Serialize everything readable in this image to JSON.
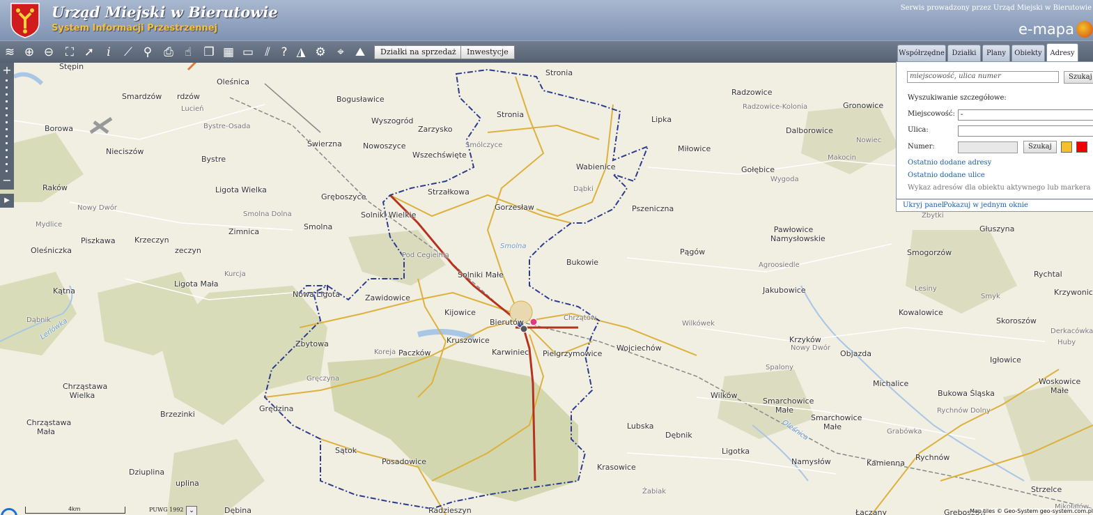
{
  "header": {
    "title": "Urząd Miejski w Bierutowie",
    "subtitle": "System Informacji Przestrzennej",
    "provider": "Serwis prowadzony przez Urząd Miejski w Bierutowie",
    "brand": "e-mapa"
  },
  "toolbar": {
    "icons": [
      "layers-icon",
      "zoom-in-icon",
      "zoom-out-icon",
      "zoom-extent-icon",
      "select-arrow-icon",
      "info-icon",
      "measure-ruler-icon",
      "measure-clip-icon",
      "print-icon",
      "pan-hand-icon",
      "copy-icon",
      "layout-icon",
      "speech-bubble-icon",
      "hatch-icon",
      "help-icon",
      "triangle-icon",
      "settings-gear-icon",
      "pin-search-icon",
      "terrain-icon"
    ],
    "btn_dzialki": "Działki na sprzedaż",
    "btn_inwestycje": "Inwestycje"
  },
  "panel": {
    "tabs": [
      "Współrzędne",
      "Działki",
      "Plany",
      "Obiekty",
      "Adresy"
    ],
    "active_tab": "Adresy",
    "search_placeholder": "miejscowość, ulica numer",
    "search_button": "Szukaj",
    "detail_heading": "Wyszukiwanie szczegółowe:",
    "label_miejscowosc": "Miejscowość:",
    "miejscowosc_value": "-",
    "label_ulica": "Ulica:",
    "ulica_value": "",
    "label_numer": "Numer:",
    "detail_search_button": "Szukaj",
    "link_recent_addresses": "Ostatnio dodane adresy",
    "link_recent_streets": "Ostatnio dodane ulice",
    "address_list_text": "Wykaz adresów dla obiektu aktywnego lub markera",
    "footer_hide": "Ukryj panel",
    "footer_single": "Pokazuj w jednym oknie"
  },
  "bottom": {
    "scale": "4km",
    "crs": "PUWG 1992",
    "attribution": "Map tiles © Geo-System geo-system.com.pl"
  },
  "map_labels": [
    "Stępin",
    "Oleśnica",
    "Bogusławice",
    "Smardzów",
    "rdzów",
    "Lucień",
    "Bystre-Osada",
    "Wyszogród",
    "Zarzysko",
    "Stronia",
    "Smólczyce",
    "Borowa",
    "Nieciszów",
    "Świerzna",
    "Nowoszyce",
    "Wszechświęte",
    "Bystre",
    "Wabienice",
    "Dąbki",
    "Raków",
    "Ligota Wielka",
    "Gręboszyce",
    "Strzałkowa",
    "Gorzesław",
    "Nowy Dwór",
    "Solniki Wielkie",
    "Smolna Dolna",
    "Mydlice",
    "Zimnica",
    "Smolna",
    "Piszkawa",
    "Krzeczyn",
    "zeczyn",
    "Pod Cegielnią",
    "Oleśniczka",
    "Kurcja",
    "Solniki Małe",
    "Ligota Mała",
    "Kątna",
    "Nowa Ligota",
    "Zawidowice",
    "Kijowice",
    "Bierutów",
    "Chrzątów",
    "Dąbnik",
    "Zbytowa",
    "Kruszowice",
    "Karwiniec",
    "Pielgrzymowice",
    "Paczków",
    "Koreja",
    "Gręczyna",
    "Chrząstawa Wielka",
    "Grędzina",
    "Brzezinki",
    "Chrząstawa Mała",
    "Sątok",
    "Posadowice",
    "Dziuplina",
    "uplina",
    "Dębina",
    "Radzieszyn",
    "Stronia",
    "Pszeniczna",
    "Bukowie",
    "Pągów",
    "Lipka",
    "Miłowice",
    "Gołębice",
    "Radzowice",
    "Radzowice-Kolonia",
    "Gronowice",
    "Dalborowice",
    "Makocin",
    "Nowiec",
    "Wygoda",
    "Zbytki",
    "Głuszyna",
    "Pawłowice Namysłowskie",
    "Smogorzów",
    "Agroosiedle",
    "Jakubowice",
    "Lesiny",
    "Smyk",
    "Rychtal",
    "Krzywonice",
    "Kowalowice",
    "Skoroszów",
    "Derkacówka",
    "Huby",
    "Wojciechów",
    "Wilkówek",
    "Krzyków",
    "Nowy Dwór",
    "Objazda",
    "Spalony",
    "Igłowice",
    "Michalice",
    "Woskowice Małe",
    "Bukowa Śląska",
    "Rychnów Dolny",
    "Wilków",
    "Smarchowice Małe",
    "Smarchowice Małe",
    "Grabówka",
    "Lubska",
    "Dębnik",
    "Ligotka",
    "Namysłów",
    "Kamienna",
    "Rychnów",
    "Krasowice",
    "Strzelce",
    "Żabiak",
    "Łączany",
    "Greboszów",
    "Mikołajów",
    "Sm"
  ]
}
